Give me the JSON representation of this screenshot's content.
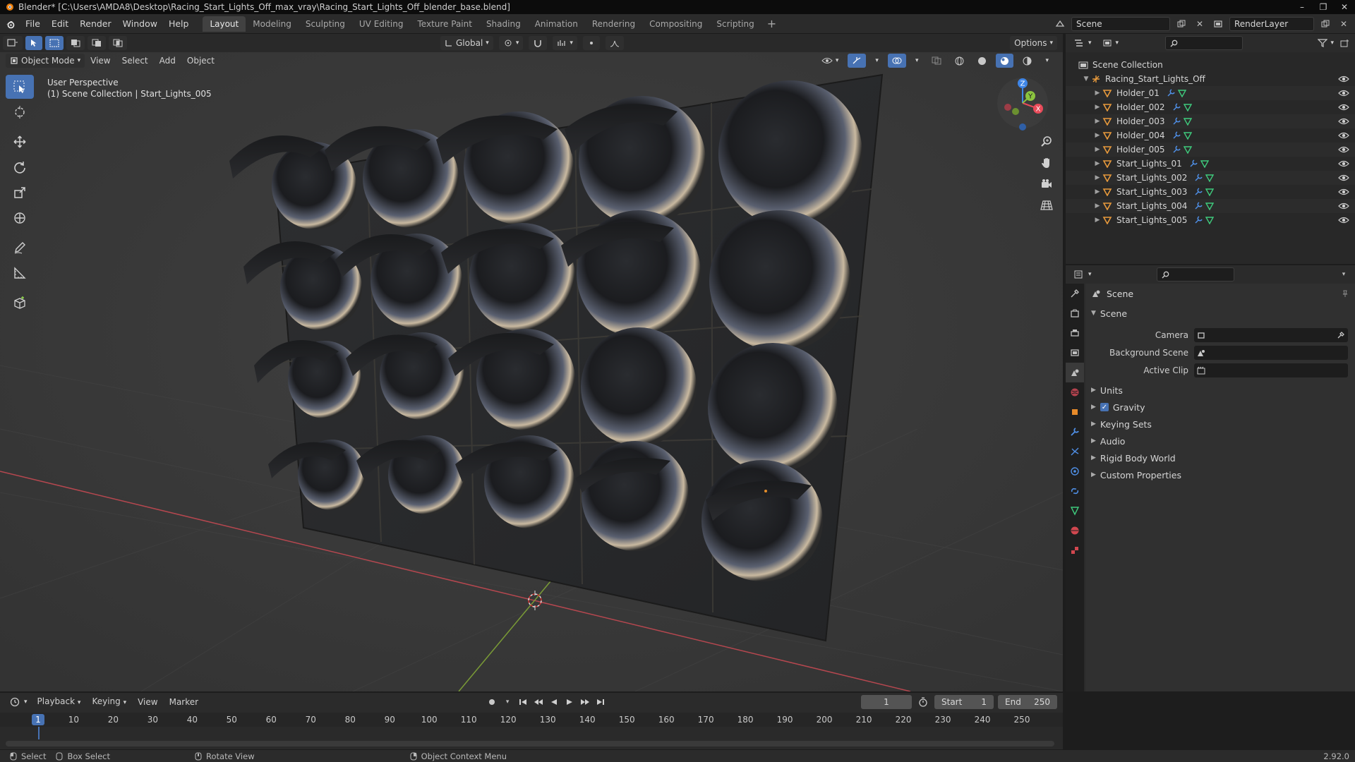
{
  "window": {
    "title": "Blender* [C:\\Users\\AMDA8\\Desktop\\Racing_Start_Lights_Off_max_vray\\Racing_Start_Lights_Off_blender_base.blend]",
    "minimize": "–",
    "maximize": "❐",
    "close": "✕"
  },
  "menubar": {
    "menus": [
      "File",
      "Edit",
      "Render",
      "Window",
      "Help"
    ],
    "workspaces": [
      "Layout",
      "Modeling",
      "Sculpting",
      "UV Editing",
      "Texture Paint",
      "Shading",
      "Animation",
      "Rendering",
      "Compositing",
      "Scripting"
    ],
    "active_workspace": "Layout",
    "add_workspace": "+",
    "scene": "Scene",
    "render_layer": "RenderLayer"
  },
  "viewport": {
    "mode": "Object Mode",
    "menus": [
      "View",
      "Select",
      "Add",
      "Object"
    ],
    "orientation": "Global",
    "options": "Options",
    "perspective_label": "User Perspective",
    "collection_label": "(1) Scene Collection | Start_Lights_005",
    "gizmo_axes": {
      "x": "X",
      "y": "Y",
      "z": "Z"
    },
    "colors": {
      "x_axis": "#e84b5a",
      "y_axis": "#8bc43f",
      "z_axis": "#3f86e8"
    }
  },
  "outliner": {
    "root": "Scene Collection",
    "collection": "Racing_Start_Lights_Off",
    "items": [
      {
        "name": "Holder_01"
      },
      {
        "name": "Holder_002"
      },
      {
        "name": "Holder_003"
      },
      {
        "name": "Holder_004"
      },
      {
        "name": "Holder_005"
      },
      {
        "name": "Start_Lights_01"
      },
      {
        "name": "Start_Lights_002"
      },
      {
        "name": "Start_Lights_003"
      },
      {
        "name": "Start_Lights_004"
      },
      {
        "name": "Start_Lights_005"
      }
    ]
  },
  "properties": {
    "context": "Scene",
    "panel": "Scene",
    "fields": [
      {
        "label": "Camera"
      },
      {
        "label": "Background Scene"
      },
      {
        "label": "Active Clip"
      }
    ],
    "subpanels": [
      "Units",
      "Gravity",
      "Keying Sets",
      "Audio",
      "Rigid Body World",
      "Custom Properties"
    ],
    "gravity_checked": "✓"
  },
  "timeline": {
    "menus": [
      "Playback",
      "Keying",
      "View",
      "Marker"
    ],
    "current_frame": "1",
    "start_label": "Start",
    "start": "1",
    "end_label": "End",
    "end": "250",
    "ticks": [
      "10",
      "20",
      "30",
      "40",
      "50",
      "60",
      "70",
      "80",
      "90",
      "100",
      "110",
      "120",
      "130",
      "140",
      "150",
      "160",
      "170",
      "180",
      "190",
      "200",
      "210",
      "220",
      "230",
      "240",
      "250"
    ],
    "cursor": "1"
  },
  "statusbar": {
    "items": [
      "Select",
      "Box Select",
      "Rotate View",
      "Object Context Menu"
    ],
    "version": "2.92.0"
  }
}
